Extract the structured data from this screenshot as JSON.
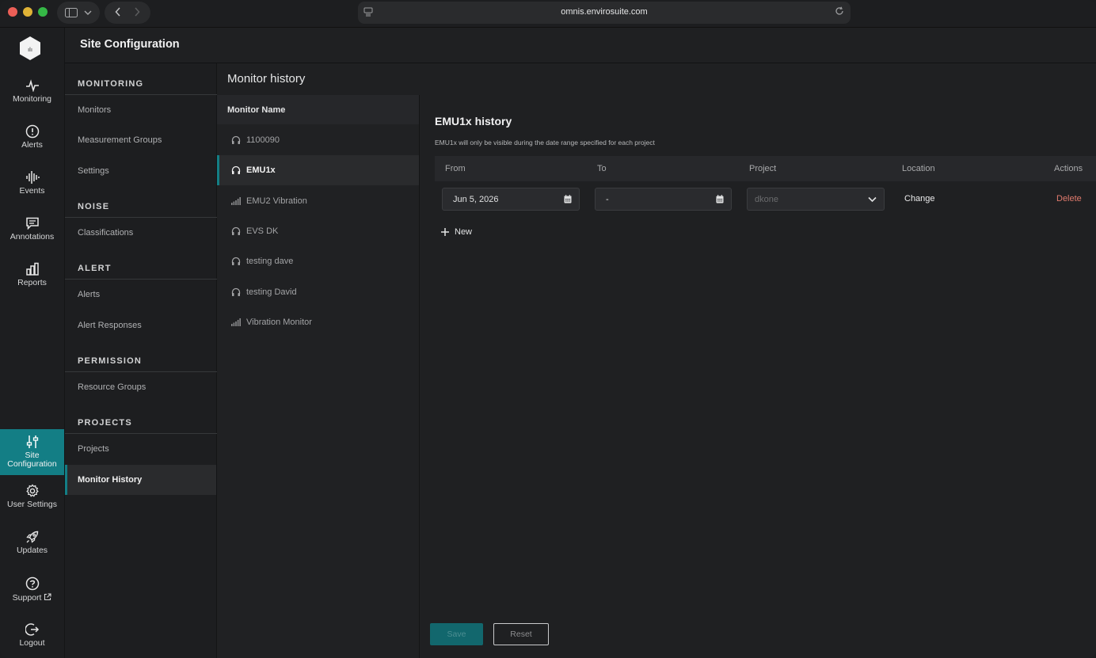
{
  "browser": {
    "url": "omnis.envirosuite.com"
  },
  "rail": {
    "items": [
      {
        "label": "Monitoring",
        "icon": "pulse-icon"
      },
      {
        "label": "Alerts",
        "icon": "alert-circle-icon"
      },
      {
        "label": "Events",
        "icon": "waveform-icon"
      },
      {
        "label": "Annotations",
        "icon": "comment-icon"
      },
      {
        "label": "Reports",
        "icon": "bar-chart-icon"
      }
    ],
    "bottom": [
      {
        "label": "Site Configuration",
        "label_line1": "Site",
        "label_line2": "Configuration",
        "icon": "sliders-icon",
        "active": true
      },
      {
        "label": "User Settings",
        "icon": "gear-icon"
      },
      {
        "label": "Updates",
        "icon": "rocket-icon"
      },
      {
        "label": "Support",
        "icon": "question-circle-icon"
      },
      {
        "label": "Logout",
        "icon": "logout-icon"
      }
    ],
    "support_suffix_icon": "external-link-icon"
  },
  "header": {
    "title": "Site Configuration"
  },
  "confnav": {
    "sections": [
      {
        "title": "MONITORING",
        "items": [
          "Monitors",
          "Measurement Groups",
          "Settings"
        ]
      },
      {
        "title": "NOISE",
        "items": [
          "Classifications"
        ]
      },
      {
        "title": "ALERT",
        "items": [
          "Alerts",
          "Alert Responses"
        ]
      },
      {
        "title": "PERMISSION",
        "items": [
          "Resource Groups"
        ]
      },
      {
        "title": "PROJECTS",
        "items": [
          "Projects",
          "Monitor History"
        ]
      }
    ],
    "active": "Monitor History"
  },
  "monitor_history": {
    "title": "Monitor history",
    "list_header": "Monitor Name",
    "monitors": [
      {
        "name": "1100090",
        "icon": "headphones-icon"
      },
      {
        "name": "EMU1x",
        "icon": "headphones-icon",
        "active": true
      },
      {
        "name": "EMU2 Vibration",
        "icon": "signal-bars-icon"
      },
      {
        "name": "EVS DK",
        "icon": "headphones-icon"
      },
      {
        "name": "testing dave",
        "icon": "headphones-icon"
      },
      {
        "name": "testing David",
        "icon": "headphones-icon"
      },
      {
        "name": "Vibration Monitor",
        "icon": "signal-bars-icon"
      }
    ]
  },
  "detail": {
    "title": "EMU1x history",
    "subtitle": "EMU1x will only be visible during the date range specified for each project",
    "columns": {
      "from": "From",
      "to": "To",
      "project": "Project",
      "location": "Location",
      "actions": "Actions"
    },
    "row": {
      "from": "Jun 5, 2026",
      "to": "-",
      "project_placeholder": "dkone",
      "location_action": "Change",
      "delete_action": "Delete"
    },
    "new_label": "New",
    "save_label": "Save",
    "reset_label": "Reset"
  },
  "colors": {
    "accent": "#137e85",
    "delete": "#e07a6d"
  }
}
